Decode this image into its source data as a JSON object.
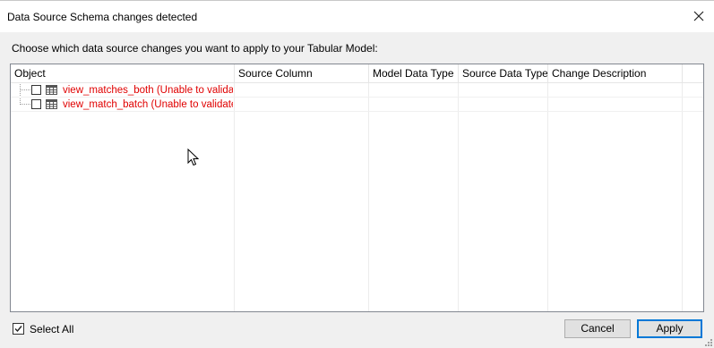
{
  "dialog": {
    "title": "Data Source Schema changes detected",
    "instruction": "Choose which data source changes you want to apply to your Tabular Model:"
  },
  "grid": {
    "columns": [
      "Object",
      "Source Column",
      "Model Data Type",
      "Source Data Type",
      "Change Description"
    ],
    "rows": [
      {
        "object": "view_matches_both (Unable to validate",
        "checked": false,
        "icon": "table-icon"
      },
      {
        "object": "view_match_batch (Unable to validate s",
        "checked": false,
        "icon": "table-icon"
      }
    ]
  },
  "footer": {
    "select_all_label": "Select All",
    "select_all_checked": true,
    "cancel_label": "Cancel",
    "apply_label": "Apply"
  },
  "colors": {
    "error_text": "#e00000",
    "accent": "#0078d7"
  }
}
